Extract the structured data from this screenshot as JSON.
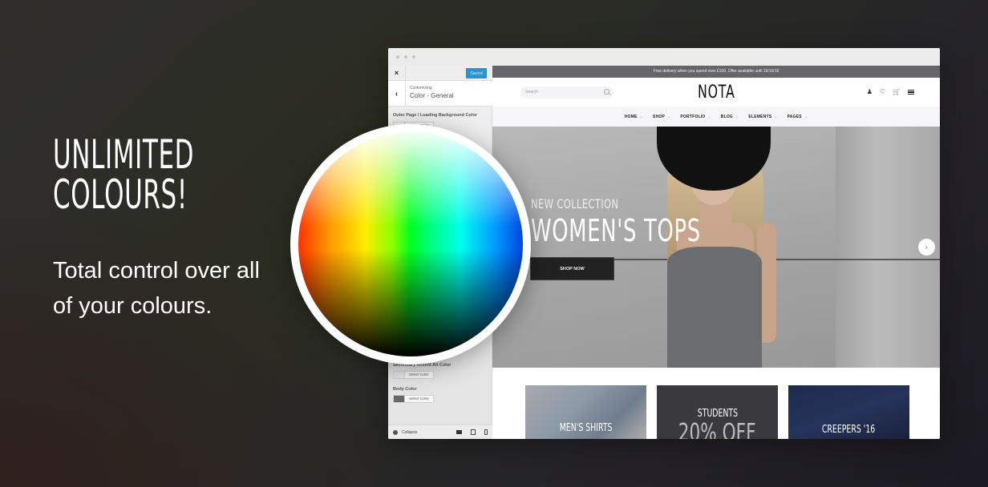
{
  "promo": {
    "title_line1": "UNLIMITED",
    "title_line2": "COLOURS!",
    "subtitle": "Total control over all of your colours."
  },
  "customizer": {
    "close_icon": "×",
    "saved_label": "Saved",
    "back_icon": "‹",
    "breadcrumb": "Customizing",
    "section_title": "Color - General",
    "settings": [
      {
        "label": "Outer Page / Loading Background Color",
        "button": "Select Color",
        "swatch": "#f5f5f5"
      },
      {
        "label": "Secondary Accent Alt Color",
        "button": "Select Color",
        "swatch": "#e6e6e6"
      },
      {
        "label": "Body Color",
        "button": "Select Color",
        "swatch": "#666666"
      }
    ],
    "collapse_label": "Collapse",
    "saved_color": "#2a94cd"
  },
  "site": {
    "announcement": "Free delivery when you spend over £100. Offer available until 16/10/16",
    "search_placeholder": "Search",
    "logo": "NOTA",
    "header_icons": [
      "user-icon",
      "heart-icon",
      "cart-icon",
      "menu-icon"
    ],
    "nav": [
      {
        "label": "HOME"
      },
      {
        "label": "SHOP"
      },
      {
        "label": "PORTFOLIO"
      },
      {
        "label": "BLOG"
      },
      {
        "label": "ELEMENTS"
      },
      {
        "label": "PAGES"
      }
    ],
    "hero": {
      "kicker": "NEW COLLECTION",
      "title": "WOMEN'S TOPS",
      "button": "SHOP NOW",
      "next_icon": "›"
    },
    "promos": [
      {
        "label": "MEN'S SHIRTS"
      },
      {
        "label": "STUDENTS",
        "big": "20% OFF"
      },
      {
        "label": "CREEPERS '16"
      }
    ]
  }
}
